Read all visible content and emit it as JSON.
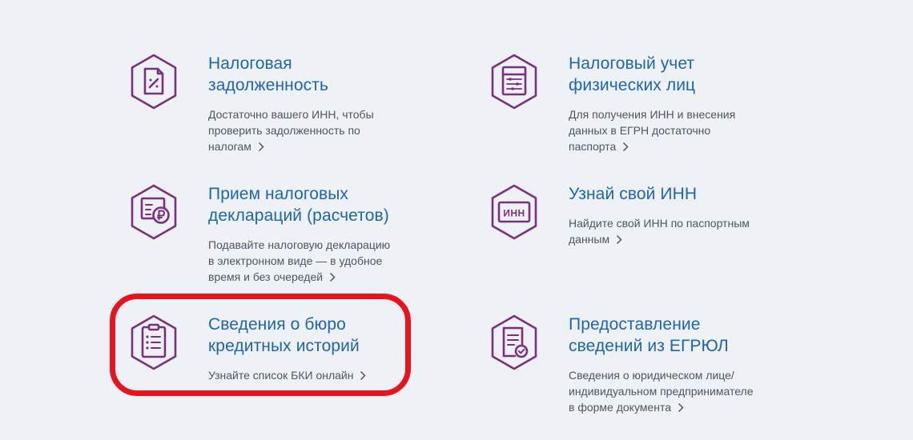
{
  "accent_color": "#1f64b0",
  "icon_color": "#7b2f7f",
  "highlight_color": "#e8141c",
  "services": [
    {
      "title_line1": "Налоговая",
      "title_line2": "задолженность",
      "desc_lines": [
        "Достаточно вашего ИНН, чтобы",
        "проверить задолженность по",
        "налогам"
      ],
      "icon": "tax-document-percent-icon"
    },
    {
      "title_line1": "Налоговый учет",
      "title_line2": "физических лиц",
      "desc_lines": [
        "Для получения ИНН и внесения",
        "данных в ЕГРН достаточно",
        "паспорта"
      ],
      "icon": "abacus-document-icon"
    },
    {
      "title_line1": "Прием налоговых",
      "title_line2": "деклараций (расчетов)",
      "desc_lines": [
        "Подавайте налоговую декларацию",
        "в электронном виде — в удобное",
        "время и без очередей"
      ],
      "icon": "ruble-declaration-icon"
    },
    {
      "title_line1": "Узнай свой ИНН",
      "title_line2": "",
      "desc_lines": [
        "Найдите свой ИНН по паспортным",
        "данным"
      ],
      "icon": "inn-card-icon",
      "inn_text": "ИНН"
    },
    {
      "title_line1": "Сведения о бюро",
      "title_line2": "кредитных историй",
      "desc_lines": [
        "Узнайте список БКИ онлайн"
      ],
      "icon": "clipboard-list-icon"
    },
    {
      "title_line1": "Предоставление",
      "title_line2": "сведений из ЕГРЮЛ",
      "desc_lines": [
        "Сведения о юридическом лице/",
        "индивидуальном предпринимателе",
        "в форме документа"
      ],
      "icon": "document-check-icon"
    }
  ]
}
